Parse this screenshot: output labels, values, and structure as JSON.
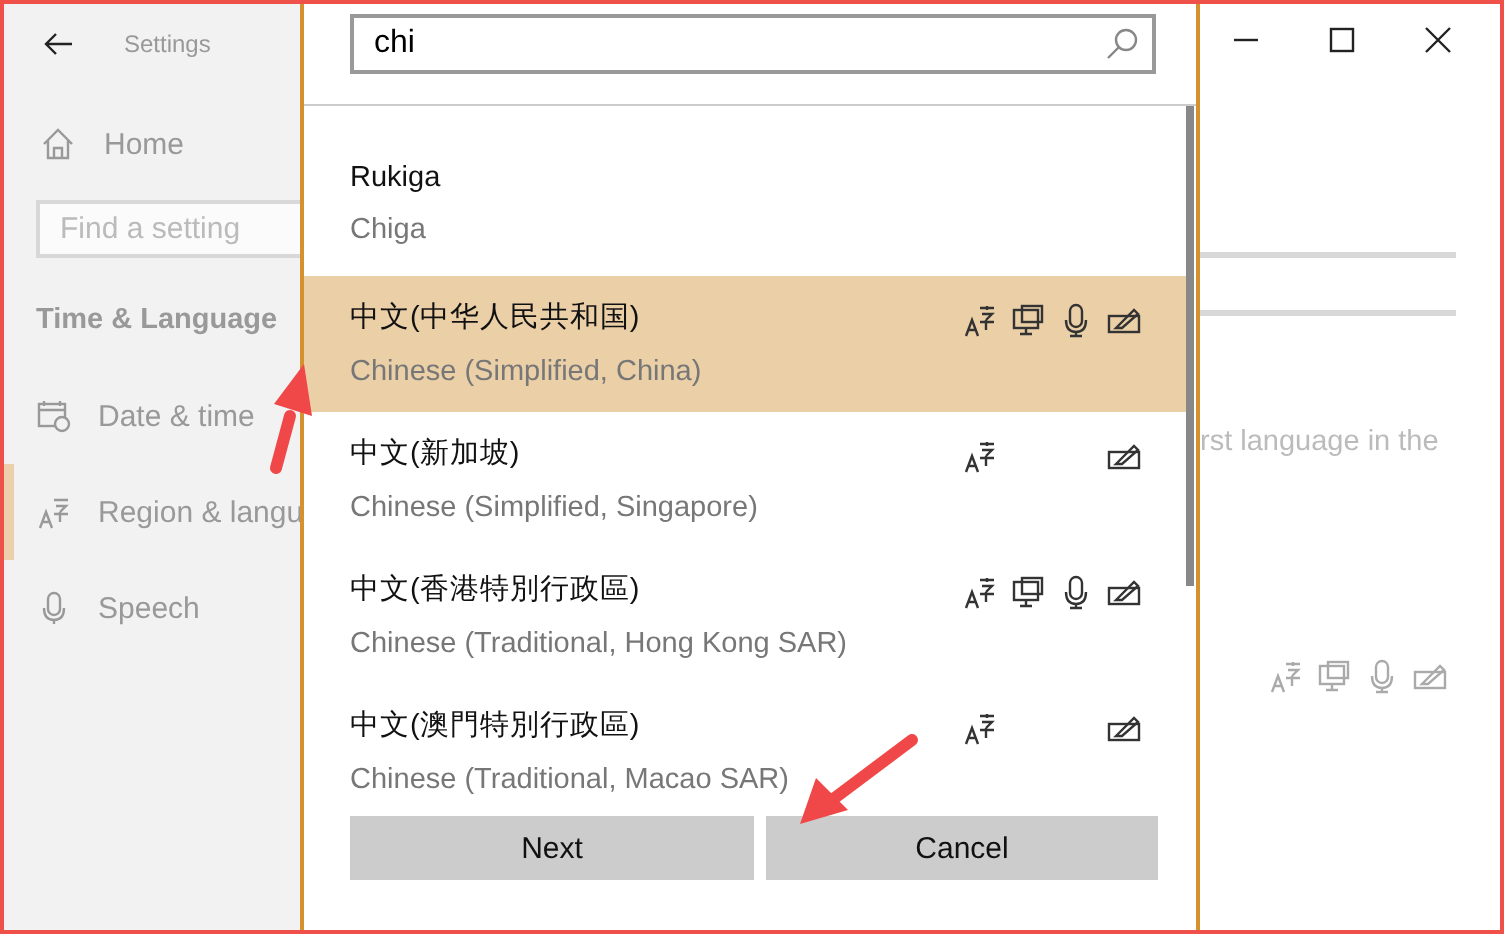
{
  "sidebar": {
    "back_title": "Settings",
    "home": "Home",
    "search": {
      "placeholder": "Find a setting"
    },
    "section": "Time & Language",
    "items": [
      {
        "label": "Date & time",
        "kind": "calendar",
        "selected": false
      },
      {
        "label": "Region & langu",
        "kind": "language",
        "selected": true
      },
      {
        "label": "Speech",
        "kind": "microphone",
        "selected": false
      }
    ]
  },
  "dialog": {
    "search": {
      "value": "chi"
    },
    "languages": [
      {
        "name": "Rukiga",
        "english": "Chiga",
        "selected": false,
        "text": false,
        "display": false,
        "speech": false,
        "handwriting": false
      },
      {
        "name": "中文(中华人民共和国)",
        "english": "Chinese (Simplified, China)",
        "selected": true,
        "text": true,
        "display": true,
        "speech": true,
        "handwriting": true
      },
      {
        "name": "中文(新加坡)",
        "english": "Chinese (Simplified, Singapore)",
        "selected": false,
        "text": true,
        "display": false,
        "speech": false,
        "handwriting": true
      },
      {
        "name": "中文(香港特別行政區)",
        "english": "Chinese (Traditional, Hong Kong SAR)",
        "selected": false,
        "text": true,
        "display": true,
        "speech": true,
        "handwriting": true
      },
      {
        "name": "中文(澳門特別行政區)",
        "english": "Chinese (Traditional, Macao SAR)",
        "selected": false,
        "text": true,
        "display": false,
        "speech": false,
        "handwriting": true
      }
    ],
    "buttons": [
      "Next",
      "Cancel"
    ]
  },
  "background": {
    "text": "rst language in the"
  }
}
